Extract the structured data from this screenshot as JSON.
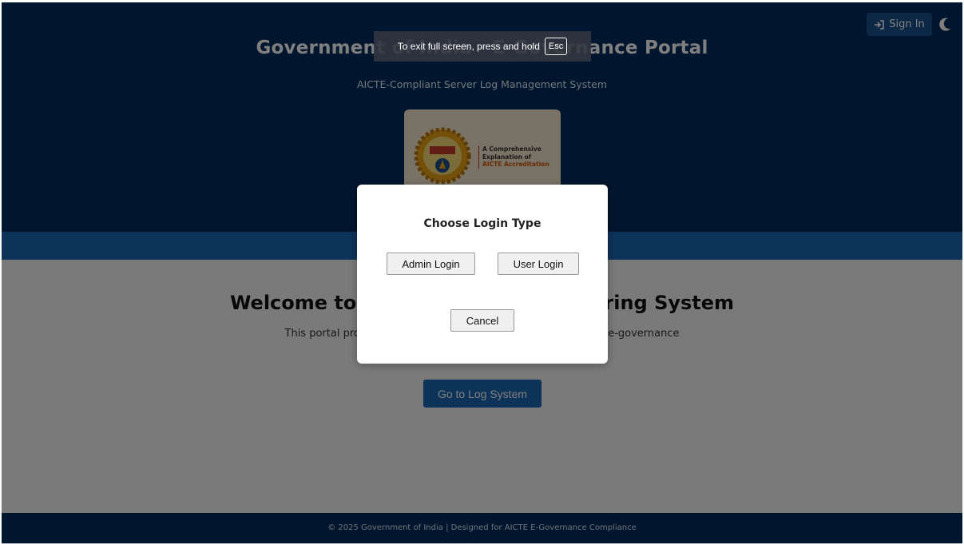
{
  "header": {
    "title": "Government of India - E-Governance Portal",
    "subtitle": "AICTE-Compliant Server Log Management System",
    "signin_label": "Sign In",
    "signin_icon": "sign-in-icon",
    "theme_icon": "moon-icon",
    "logo": {
      "seal_text": "AICTE",
      "line1": "A Comprehensive",
      "line2": "Explanation of",
      "line3": "AICTE Accreditation"
    }
  },
  "main": {
    "welcome_title": "Welcome to the Server Log Monitoring System",
    "welcome_text": "This portal provides secure server log management for AICTE e-governance",
    "go_button": "Go to Log System"
  },
  "footer": {
    "text": "© 2025 Government of India | Designed for AICTE E-Governance Compliance"
  },
  "fullscreen_toast": {
    "text": "To exit full screen, press and hold",
    "key": "Esc"
  },
  "modal": {
    "title": "Choose Login Type",
    "admin_button": "Admin Login",
    "user_button": "User Login",
    "cancel_button": "Cancel"
  },
  "colors": {
    "header_bg": "#002b5c",
    "nav_band": "#1a66b3",
    "accent": "#1a66b3"
  }
}
